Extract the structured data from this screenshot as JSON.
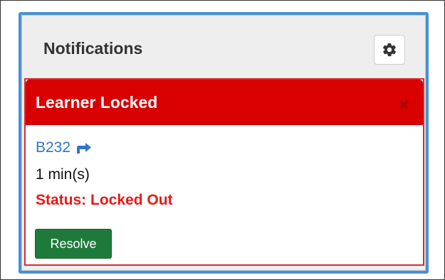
{
  "panel": {
    "title": "Notifications",
    "settings_icon": "gear-icon"
  },
  "notification": {
    "title": "Learner Locked",
    "close_symbol": "×",
    "device_id": "B232",
    "link_icon": "share-arrow-icon",
    "duration": "1 min(s)",
    "status": "Status: Locked Out",
    "resolve_label": "Resolve"
  },
  "colors": {
    "header_red": "#d80000",
    "status_red": "#e81818",
    "link_blue": "#2f76c6",
    "resolve_green": "#1e7a3a",
    "panel_border_blue": "#4a8fd6"
  }
}
